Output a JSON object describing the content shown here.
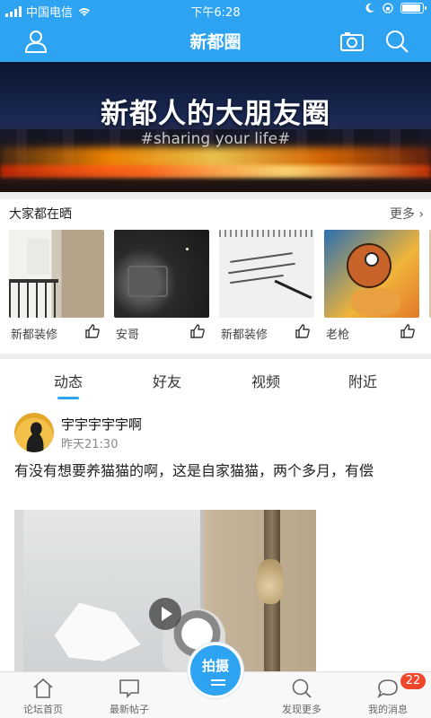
{
  "status_bar": {
    "carrier": "中国电信",
    "time": "下午6:28",
    "battery_level": 0.85
  },
  "nav": {
    "title": "新都圈",
    "left_icon": "user-icon",
    "right_icons": [
      "camera-icon",
      "search-icon"
    ]
  },
  "banner": {
    "title": "新都人的大朋友圈",
    "subtitle": "#sharing your life#"
  },
  "showcase": {
    "header": "大家都在晒",
    "more": "更多 ›",
    "items": [
      {
        "caption": "新都装修"
      },
      {
        "caption": "安哥"
      },
      {
        "caption": "新都装修"
      },
      {
        "caption": "老枪"
      }
    ]
  },
  "tabs": [
    {
      "label": "动态",
      "active": true
    },
    {
      "label": "好友",
      "active": false
    },
    {
      "label": "视频",
      "active": false
    },
    {
      "label": "附近",
      "active": false
    }
  ],
  "post": {
    "user": "宇宇宇宇宇啊",
    "time": "昨天21:30",
    "text": "有没有想要养猫猫的啊，这是自家猫猫，两个多月，有偿"
  },
  "bottom_bar": {
    "items": [
      {
        "label": "论坛首页",
        "icon": "home-icon"
      },
      {
        "label": "最新帖子",
        "icon": "chat-square-icon"
      },
      {
        "label": "发现更多",
        "icon": "search-icon"
      },
      {
        "label": "我的消息",
        "icon": "message-icon"
      }
    ],
    "shoot_label": "拍摄",
    "message_badge": "22"
  },
  "colors": {
    "accent": "#2ea3f2",
    "badge": "#f0462a"
  }
}
